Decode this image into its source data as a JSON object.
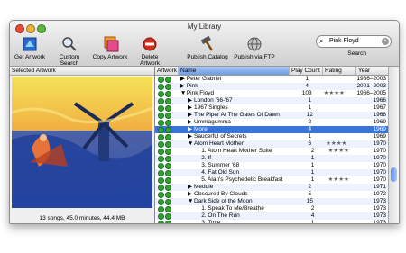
{
  "window": {
    "title": "My Library"
  },
  "toolbar": [
    {
      "label": "Get Artwork",
      "icon": "get-artwork-icon",
      "name": "get-artwork-button"
    },
    {
      "label": "Custom Search",
      "icon": "magnifier-icon",
      "name": "custom-search-button"
    },
    {
      "label": "Copy Artwork",
      "icon": "copy-artwork-icon",
      "name": "copy-artwork-button"
    },
    {
      "label": "Delete Artwork",
      "icon": "no-entry-icon",
      "name": "delete-artwork-button"
    },
    {
      "label": "Publish Catalog",
      "icon": "hammer-icon",
      "name": "publish-catalog-button"
    },
    {
      "label": "Publish via FTP",
      "icon": "ftp-icon",
      "name": "publish-ftp-button"
    }
  ],
  "search": {
    "value": "Pink Floyd",
    "label": "Search"
  },
  "left_pane": {
    "header": "Selected Artwork",
    "footer": "13 songs, 45.0 minutes, 44.4 MB"
  },
  "columns": {
    "artwork": "Artwork",
    "name": "Name",
    "play_count": "Play Count",
    "rating": "Rating",
    "year": "Year"
  },
  "rows": [
    {
      "name": "Peter Gabriel",
      "indent": 0,
      "disc": "▶",
      "pc": "1",
      "rt": "",
      "yr": "1986–2003",
      "sel": false
    },
    {
      "name": "Pink",
      "indent": 0,
      "disc": "▶",
      "pc": "4",
      "rt": "",
      "yr": "2001–2003",
      "sel": false
    },
    {
      "name": "Pink Floyd",
      "indent": 0,
      "disc": "▼",
      "pc": "103",
      "rt": "★★★★",
      "yr": "1966–2005",
      "sel": false
    },
    {
      "name": "London '66-'67",
      "indent": 1,
      "disc": "▶",
      "pc": "1",
      "rt": "",
      "yr": "1966",
      "sel": false
    },
    {
      "name": "1967 Singles",
      "indent": 1,
      "disc": "▶",
      "pc": "1",
      "rt": "",
      "yr": "1967",
      "sel": false
    },
    {
      "name": "The Piper At The Gates Of Dawn",
      "indent": 1,
      "disc": "▶",
      "pc": "12",
      "rt": "",
      "yr": "1968",
      "sel": false
    },
    {
      "name": "Ummagumma",
      "indent": 1,
      "disc": "▶",
      "pc": "2",
      "rt": "",
      "yr": "1969",
      "sel": false
    },
    {
      "name": "More",
      "indent": 1,
      "disc": "▶",
      "pc": "4",
      "rt": "",
      "yr": "1969",
      "sel": true
    },
    {
      "name": "Saucerful of Secrets",
      "indent": 1,
      "disc": "▶",
      "pc": "1",
      "rt": "",
      "yr": "1969",
      "sel": false
    },
    {
      "name": "Atom Heart Mother",
      "indent": 1,
      "disc": "▼",
      "pc": "6",
      "rt": "★★★★",
      "yr": "1970",
      "sel": false
    },
    {
      "name": "1. Atom Heart Mother Suite",
      "indent": 2,
      "disc": "",
      "pc": "2",
      "rt": "★★★★",
      "yr": "1970",
      "sel": false
    },
    {
      "name": "2. If",
      "indent": 2,
      "disc": "",
      "pc": "1",
      "rt": "",
      "yr": "1970",
      "sel": false
    },
    {
      "name": "3. Summer '68",
      "indent": 2,
      "disc": "",
      "pc": "1",
      "rt": "",
      "yr": "1970",
      "sel": false
    },
    {
      "name": "4. Fat Old Sun",
      "indent": 2,
      "disc": "",
      "pc": "1",
      "rt": "",
      "yr": "1970",
      "sel": false
    },
    {
      "name": "5. Alan's Psychedelic Breakfast",
      "indent": 2,
      "disc": "",
      "pc": "1",
      "rt": "★★★★",
      "yr": "1970",
      "sel": false
    },
    {
      "name": "Meddle",
      "indent": 1,
      "disc": "▶",
      "pc": "2",
      "rt": "",
      "yr": "1971",
      "sel": false
    },
    {
      "name": "Obscured By Clouds",
      "indent": 1,
      "disc": "▶",
      "pc": "5",
      "rt": "",
      "yr": "1972",
      "sel": false
    },
    {
      "name": "Dark Side of the Moon",
      "indent": 1,
      "disc": "▼",
      "pc": "15",
      "rt": "",
      "yr": "1973",
      "sel": false
    },
    {
      "name": "1. Speak To Me/Breathe",
      "indent": 2,
      "disc": "",
      "pc": "2",
      "rt": "",
      "yr": "1973",
      "sel": false
    },
    {
      "name": "2. On The Run",
      "indent": 2,
      "disc": "",
      "pc": "4",
      "rt": "",
      "yr": "1973",
      "sel": false
    },
    {
      "name": "3. Time",
      "indent": 2,
      "disc": "",
      "pc": "1",
      "rt": "",
      "yr": "1973",
      "sel": false
    }
  ]
}
